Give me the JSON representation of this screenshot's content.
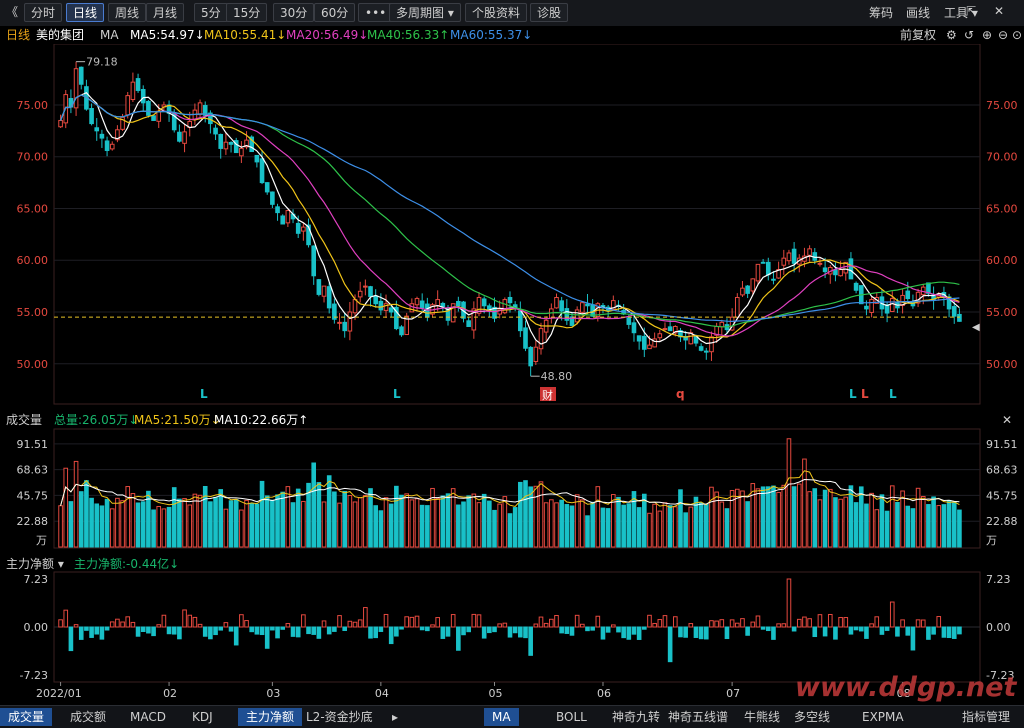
{
  "toolbar": {
    "back_icon": "chevron-left-icon",
    "buttons": [
      {
        "label": "分时"
      },
      {
        "label": "日线",
        "active": true
      },
      {
        "label": "周线"
      },
      {
        "label": "月线"
      },
      {
        "label": "5分"
      },
      {
        "label": "15分"
      },
      {
        "label": "30分"
      },
      {
        "label": "60分"
      },
      {
        "label": "•••"
      },
      {
        "label": "多周期图 ▾"
      },
      {
        "label": "个股资料"
      },
      {
        "label": "诊股"
      }
    ],
    "right": [
      {
        "label": "筹码"
      },
      {
        "label": "画线"
      },
      {
        "label": "工具 ▾"
      }
    ],
    "window_icons": [
      "restore-icon",
      "close-icon"
    ]
  },
  "infobar": {
    "period": "日线",
    "stock": "美的集团",
    "ma_label": "MA",
    "ma5": "MA5:54.97↓",
    "ma10": "MA10:55.41↓",
    "ma20": "MA20:56.49↓",
    "ma40": "MA40:56.33↑",
    "ma60": "MA60:55.37↓",
    "adjust": "前复权",
    "colors": {
      "ma5": "#ffffff",
      "ma10": "#f0c419",
      "ma20": "#e040c0",
      "ma40": "#2ec24a",
      "ma60": "#3d8fe8"
    }
  },
  "price_axis": {
    "ticks": [
      "75.00",
      "70.00",
      "65.00",
      "60.00",
      "55.00",
      "50.00"
    ],
    "values": [
      75,
      70,
      65,
      60,
      55,
      50
    ],
    "range": [
      46.5,
      80.5
    ]
  },
  "annotations": {
    "high": "79.18",
    "low": "48.80",
    "report": "财",
    "dashed_level": 54.5
  },
  "markers": [
    "L",
    "L",
    "q",
    "L",
    "L",
    "L"
  ],
  "volume_panel": {
    "title": "成交量",
    "total": "总量:26.05万↓",
    "ma5": "MA5:21.50万↓",
    "ma10": "MA10:22.66万↑",
    "ticks": [
      "91.51",
      "68.63",
      "45.75",
      "22.88"
    ],
    "unit": "万",
    "close_icon": "close-icon"
  },
  "flow_panel": {
    "title": "主力净额 ▾",
    "value": "主力净额:-0.44亿↓",
    "ticks": [
      "7.23",
      "0.00",
      "-7.23"
    ]
  },
  "time_axis": [
    "2022/01",
    "02",
    "03",
    "04",
    "05",
    "06",
    "07",
    "08"
  ],
  "tabs_left": [
    {
      "label": "成交量",
      "active": true
    },
    {
      "label": "成交额"
    },
    {
      "label": "MACD"
    },
    {
      "label": "KDJ"
    },
    {
      "label": "主力净额",
      "active": true
    },
    {
      "label": "L2-资金抄底"
    }
  ],
  "tabs_right": [
    {
      "label": "MA",
      "active": true
    },
    {
      "label": "BOLL"
    },
    {
      "label": "神奇九转"
    },
    {
      "label": "神奇五线谱"
    },
    {
      "label": "牛熊线"
    },
    {
      "label": "多空线"
    },
    {
      "label": "EXPMA"
    },
    {
      "label": "指标管理"
    }
  ],
  "watermark": "www.ddgp.net",
  "chart_data": {
    "type": "candlestick",
    "title": "美的集团 日线",
    "x_labels": [
      "2022/01",
      "02",
      "03",
      "04",
      "05",
      "06",
      "07",
      "08"
    ],
    "price_range": [
      46.5,
      80.5
    ],
    "closes": [
      73.5,
      76.0,
      74.8,
      78.5,
      77.0,
      74.6,
      73.2,
      72.5,
      71.8,
      70.6,
      71.2,
      72.6,
      73.8,
      75.9,
      77.2,
      76.4,
      75.2,
      74.0,
      73.5,
      74.4,
      75.0,
      74.2,
      72.6,
      71.5,
      72.4,
      73.4,
      74.5,
      75.2,
      74.0,
      73.2,
      72.2,
      70.8,
      71.4,
      71.2,
      70.4,
      70.8,
      71.6,
      70.5,
      69.5,
      67.5,
      66.6,
      65.4,
      64.6,
      63.5,
      64.8,
      64.0,
      62.6,
      63.2,
      61.5,
      58.5,
      56.7,
      57.5,
      55.4,
      54.3,
      54.0,
      53.2,
      55.0,
      56.2,
      57.0,
      57.5,
      56.5,
      55.8,
      55.2,
      55.8,
      55.0,
      53.4,
      52.8,
      54.6,
      55.8,
      56.3,
      55.4,
      54.5,
      55.7,
      56.2,
      55.5,
      54.2,
      55.8,
      55.6,
      54.4,
      53.6,
      55.3,
      56.4,
      55.6,
      55.1,
      54.4,
      55.3,
      56.2,
      55.9,
      55.4,
      53.2,
      51.5,
      49.8,
      51.6,
      53.4,
      54.2,
      55.3,
      56.4,
      55.1,
      54.2,
      53.7,
      55.2,
      55.9,
      55.6,
      54.6,
      55.8,
      55.4,
      55.1,
      56.1,
      55.6,
      54.8,
      53.8,
      53.0,
      52.2,
      51.4,
      51.8,
      52.4,
      52.9,
      53.4,
      53.2,
      53.6,
      52.6,
      52.3,
      53.0,
      52.0,
      51.3,
      51.2,
      52.6,
      53.6,
      54.0,
      53.3,
      54.5,
      56.4,
      57.3,
      56.8,
      58.2,
      59.6,
      59.8,
      58.6,
      58.1,
      59.1,
      60.2,
      60.7,
      59.7,
      60.2,
      60.4,
      61.1,
      60.0,
      59.7,
      58.9,
      59.3,
      58.6,
      59.1,
      59.8,
      58.2,
      57.1,
      55.8,
      55.3,
      56.2,
      56.4,
      55.3,
      54.9,
      56.3,
      55.4,
      56.6,
      56.3,
      55.6,
      56.9,
      57.4,
      56.8,
      56.2,
      56.7,
      56.4,
      55.3,
      54.6,
      54.1
    ],
    "volume_range": [
      0,
      102
    ],
    "volume_ticks": [
      22.88,
      45.75,
      68.63,
      91.51
    ],
    "volume_unit": "万",
    "flow_range": [
      -7.8,
      7.8
    ],
    "flow_ticks": [
      7.23,
      0.0,
      -7.23
    ],
    "flow_unit": "亿",
    "ma_periods": [
      5,
      10,
      20,
      40,
      60
    ]
  }
}
